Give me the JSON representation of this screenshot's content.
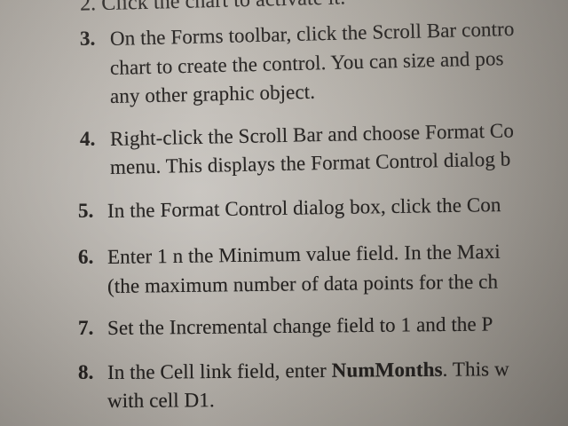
{
  "page": {
    "top_fragment": "2. Click the chart to activate it.",
    "items": [
      {
        "number": "3.",
        "lines": [
          "On the Forms toolbar, click the Scroll Bar contro",
          "chart to create the control. You can size and pos",
          "any other graphic object."
        ]
      },
      {
        "number": "4.",
        "lines": [
          "Right-click the Scroll Bar and choose Format Co",
          "menu. This displays the Format Control dialog b"
        ]
      },
      {
        "number": "5.",
        "lines": [
          "In the Format Control dialog box, click the Con"
        ]
      },
      {
        "number": "6.",
        "lines": [
          "Enter 1 n the Minimum value field. In the Maxi",
          "(the maximum number of data points for the ch"
        ]
      },
      {
        "number": "7.",
        "lines": [
          "Set the Incremental change field to 1 and the P"
        ]
      },
      {
        "number": "8.",
        "lines_prefix": "In the Cell link field, enter ",
        "cell_link_value": "NumMonths",
        "lines_suffix": ". This w",
        "lines_2": "with cell D1."
      }
    ]
  }
}
